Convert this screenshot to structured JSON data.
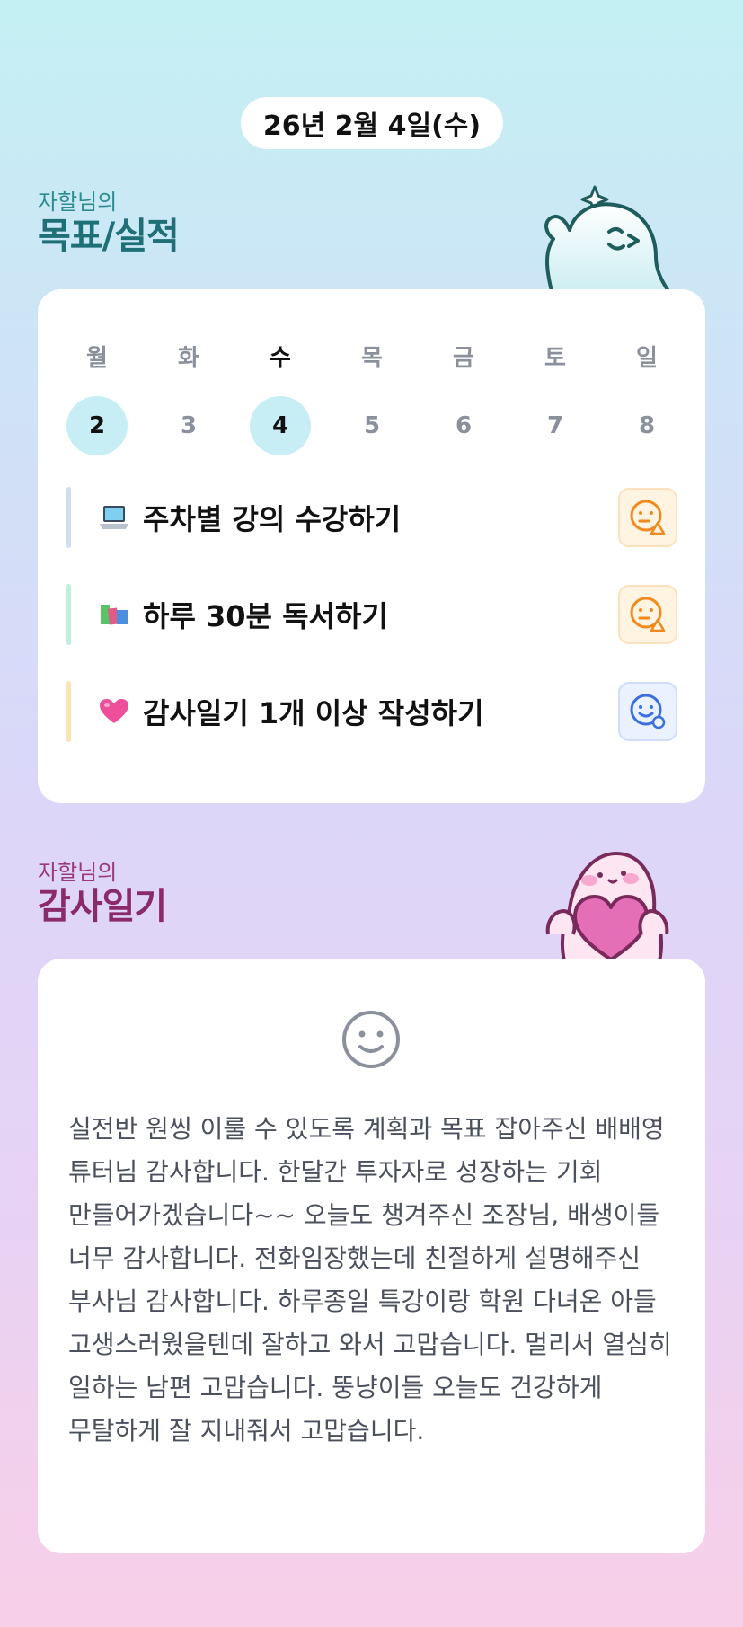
{
  "header": {
    "date": "26년 2월 4일(수)"
  },
  "goals_section": {
    "label_small": "자할님의",
    "label_big": "목표/실적",
    "week": {
      "days": [
        "월",
        "화",
        "수",
        "목",
        "금",
        "토",
        "일"
      ],
      "dates": [
        "2",
        "3",
        "4",
        "5",
        "6",
        "7",
        "8"
      ],
      "active_day_index": 2,
      "circled_date_indices": [
        0,
        2
      ]
    },
    "items": [
      {
        "emoji": "laptop-icon",
        "text": "주차별 강의 수강하기",
        "bar_color": "#d3dcf5",
        "status": "warning-face-icon",
        "status_color": "#f08a1c"
      },
      {
        "emoji": "books-icon",
        "text": "하루 30분 독서하기",
        "bar_color": "#bff0dc",
        "status": "warning-face-icon",
        "status_color": "#f08a1c"
      },
      {
        "emoji": "heart-icon",
        "text": "감사일기 1개 이상 작성하기",
        "bar_color": "#fbe3b4",
        "status": "done-face-icon",
        "status_color": "#3b6fe0"
      }
    ]
  },
  "gratitude_section": {
    "label_small": "자할님의",
    "label_big": "감사일기",
    "mood_icon": "smile-icon",
    "text": "실전반 원씽 이룰 수 있도록 계획과 목표 잡아주신 배배영 튜터님 감사합니다. 한달간 투자자로 성장하는 기회 만들어가겠습니다~~ 오늘도 챙겨주신 조장님, 배생이들 너무 감사합니다. 전화임장했는데 친절하게 설명해주신 부사님 감사합니다. 하루종일 특강이랑 학원 다녀온 아들 고생스러웠을텐데 잘하고 와서 고맙습니다. 멀리서 열심히 일하는 남편 고맙습니다. 뚱냥이들 오늘도 건강하게 무탈하게 잘 지내줘서 고맙습니다."
  },
  "colors": {
    "accent_teal": "#1f6f76",
    "accent_plum": "#8a2a6a",
    "circle_bg": "#c6eef4",
    "warning_orange": "#f08a1c",
    "done_blue": "#3b6fe0"
  }
}
